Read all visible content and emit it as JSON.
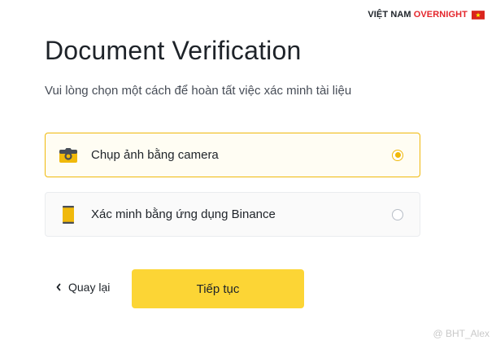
{
  "brand": {
    "part1": "VIỆT NAM",
    "part2": "OVERNIGHT",
    "flag_icon": "vietnam-flag-icon"
  },
  "colors": {
    "accent": "#f0b90b",
    "button": "#fcd535",
    "brand_red": "#e4262c",
    "text": "#1e2329",
    "muted": "#474d57"
  },
  "page": {
    "title": "Document Verification",
    "subtitle": "Vui lòng chọn một cách để hoàn tất việc xác minh tài liệu"
  },
  "options": [
    {
      "label": "Chụp ảnh bằng camera",
      "icon": "camera-icon",
      "selected": true
    },
    {
      "label": "Xác minh bằng ứng dụng Binance",
      "icon": "phone-icon",
      "selected": false
    }
  ],
  "actions": {
    "back_label": "Quay lại",
    "next_label": "Tiếp tục"
  },
  "watermark": "@ BHT_Alex"
}
